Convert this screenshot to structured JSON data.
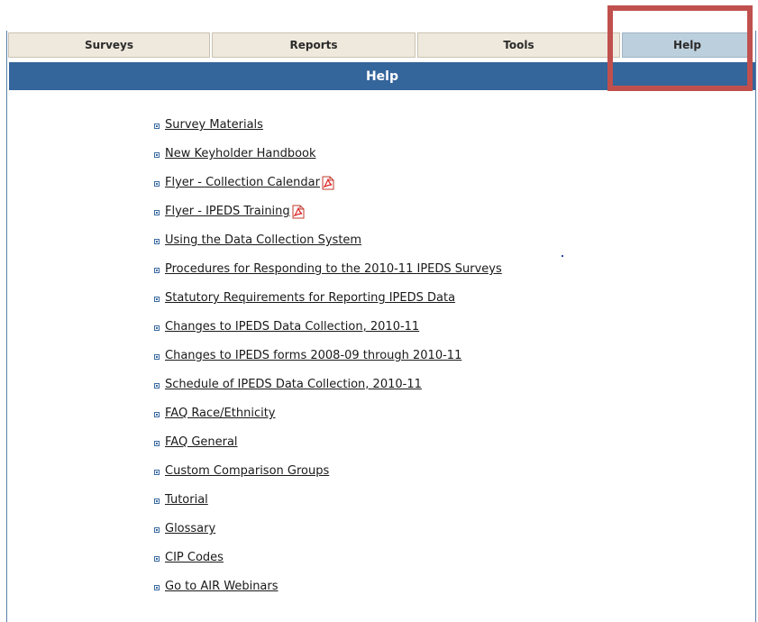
{
  "nav": {
    "tabs": [
      {
        "label": "Surveys"
      },
      {
        "label": "Reports"
      },
      {
        "label": "Tools"
      },
      {
        "label": "Help"
      }
    ],
    "active": "Help"
  },
  "page": {
    "title": "Help"
  },
  "links": [
    {
      "label": "Survey Materials",
      "pdf": false
    },
    {
      "label": "New Keyholder Handbook",
      "pdf": false
    },
    {
      "label": "Flyer - Collection Calendar ",
      "pdf": true
    },
    {
      "label": "Flyer - IPEDS Training ",
      "pdf": true
    },
    {
      "label": "Using the Data Collection System",
      "pdf": false
    },
    {
      "label": "Procedures for Responding to the 2010-11 IPEDS Surveys",
      "pdf": false
    },
    {
      "label": "Statutory Requirements for Reporting IPEDS Data",
      "pdf": false
    },
    {
      "label": "Changes to IPEDS Data Collection, 2010-11",
      "pdf": false
    },
    {
      "label": "Changes to IPEDS forms 2008-09 through 2010-11",
      "pdf": false
    },
    {
      "label": "Schedule of IPEDS Data Collection, 2010-11",
      "pdf": false
    },
    {
      "label": "FAQ Race/Ethnicity",
      "pdf": false
    },
    {
      "label": "FAQ General",
      "pdf": false
    },
    {
      "label": "Custom Comparison Groups",
      "pdf": false
    },
    {
      "label": "Tutorial",
      "pdf": false
    },
    {
      "label": "Glossary",
      "pdf": false
    },
    {
      "label": "CIP Codes",
      "pdf": false
    },
    {
      "label": "Go to AIR Webinars",
      "pdf": false
    }
  ],
  "colors": {
    "title_bar": "#34659b",
    "tab_bg": "#efe9dd",
    "active_tab_bg": "#bccfdc",
    "highlight": "#c0504d"
  },
  "icons": {
    "pdf": "pdf-file-icon",
    "bullet": "square-bullet-icon"
  }
}
